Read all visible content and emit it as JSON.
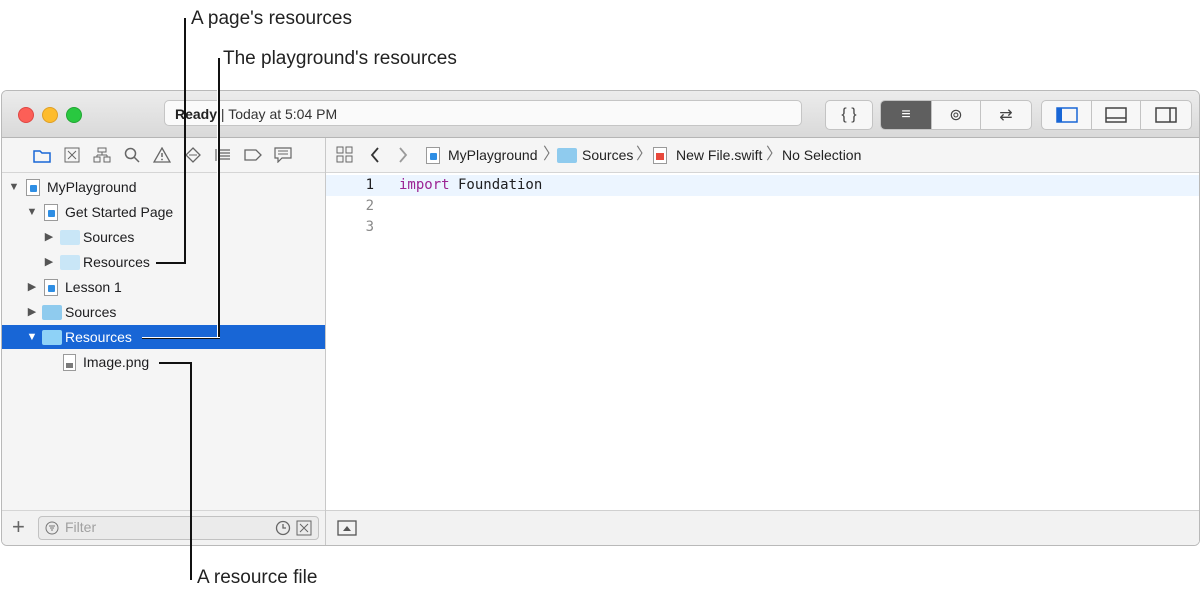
{
  "callouts": {
    "page_resources": "A page's resources",
    "playground_resources": "The playground's resources",
    "resource_file": "A resource file"
  },
  "titlebar": {
    "status_bold": "Ready",
    "status_rest": " | Today at 5:04 PM"
  },
  "toolbar": {
    "editor_buttons": [
      "{ }",
      "≡",
      "⊚",
      "⇄"
    ],
    "active_editor": 1
  },
  "navigator": {
    "tree": [
      {
        "label": "MyPlayground",
        "icon": "swift-file-icon",
        "expanded": true
      },
      {
        "label": "Get Started Page",
        "icon": "swift-file-icon",
        "expanded": true
      },
      {
        "label": "Sources",
        "icon": "folder-icon",
        "expanded": false
      },
      {
        "label": "Resources",
        "icon": "folder-icon",
        "expanded": false
      },
      {
        "label": "Lesson 1",
        "icon": "swift-file-icon",
        "expanded": false
      },
      {
        "label": "Sources",
        "icon": "folder-icon",
        "expanded": false
      },
      {
        "label": "Resources",
        "icon": "folder-icon",
        "expanded": true,
        "selected": true
      },
      {
        "label": "Image.png",
        "icon": "image-file-icon"
      }
    ],
    "filter_placeholder": "Filter"
  },
  "jumpbar": {
    "items": [
      "MyPlayground",
      "Sources",
      "New File.swift",
      "No Selection"
    ]
  },
  "editor": {
    "lines": [
      {
        "number": "1",
        "keyword": "import",
        "text": " Foundation"
      },
      {
        "number": "2",
        "keyword": "",
        "text": ""
      },
      {
        "number": "3",
        "keyword": "",
        "text": ""
      }
    ]
  },
  "colors": {
    "selection": "#1866d6",
    "keyword": "#9b2393",
    "current_line": "#ecf5ff"
  }
}
